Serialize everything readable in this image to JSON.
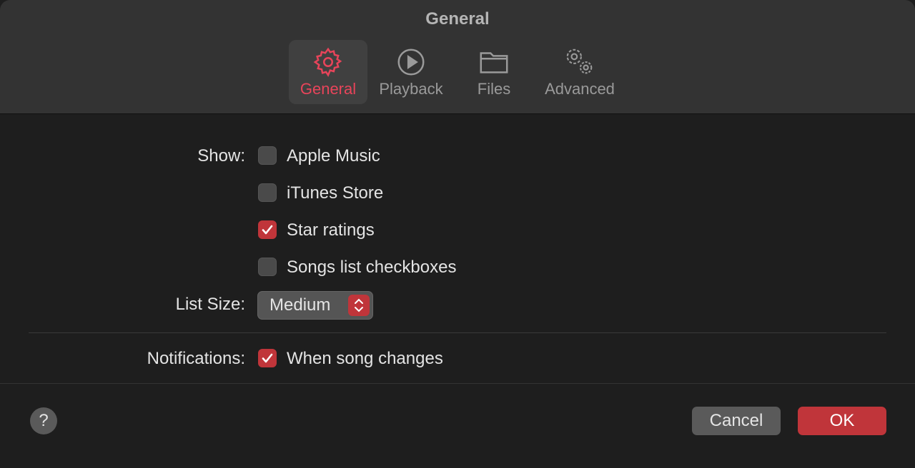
{
  "window": {
    "title": "General"
  },
  "tabs": [
    {
      "label": "General",
      "icon": "gear-icon",
      "selected": true
    },
    {
      "label": "Playback",
      "icon": "play-circle-icon"
    },
    {
      "label": "Files",
      "icon": "folder-icon"
    },
    {
      "label": "Advanced",
      "icon": "gears-icon"
    }
  ],
  "show": {
    "label": "Show:",
    "options": [
      {
        "label": "Apple Music",
        "checked": false
      },
      {
        "label": "iTunes Store",
        "checked": false
      },
      {
        "label": "Star ratings",
        "checked": true
      },
      {
        "label": "Songs list checkboxes",
        "checked": false
      }
    ]
  },
  "list_size": {
    "label": "List Size:",
    "value": "Medium"
  },
  "notifications": {
    "label": "Notifications:",
    "option": {
      "label": "When song changes",
      "checked": true
    }
  },
  "footer": {
    "help": "?",
    "cancel": "Cancel",
    "ok": "OK"
  },
  "colors": {
    "accent": "#c0353a",
    "selected_tab": "#e8445a"
  }
}
